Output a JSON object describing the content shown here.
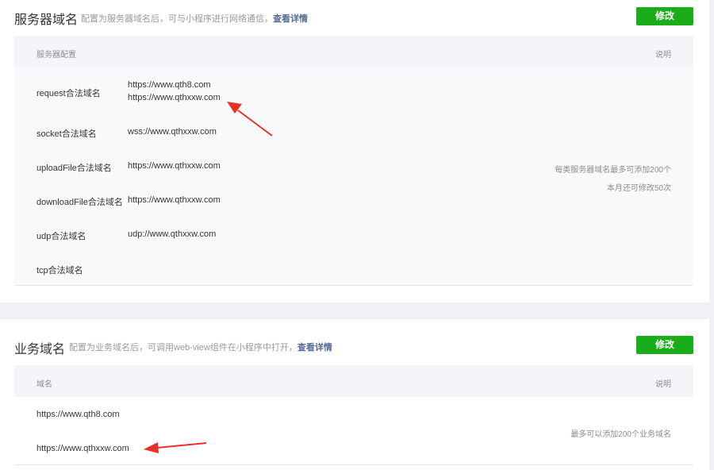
{
  "server_domain": {
    "title": "服务器域名",
    "desc_text": "配置为服务器域名后，可与小程序进行网络通信，",
    "desc_link": "查看详情",
    "button_label": "修改",
    "header_left": "服务器配置",
    "header_right": "说明",
    "rows": [
      {
        "label": "request合法域名",
        "values": [
          "https://www.qth8.com",
          "https://www.qthxxw.com"
        ]
      },
      {
        "label": "socket合法域名",
        "values": [
          "wss://www.qthxxw.com"
        ]
      },
      {
        "label": "uploadFile合法域名",
        "values": [
          "https://www.qthxxw.com"
        ]
      },
      {
        "label": "downloadFile合法域名",
        "values": [
          "https://www.qthxxw.com"
        ]
      },
      {
        "label": "udp合法域名",
        "values": [
          "udp://www.qthxxw.com"
        ]
      },
      {
        "label": "tcp合法域名",
        "values": []
      }
    ],
    "note_line1": "每类服务器域名最多可添加200个",
    "note_line2": "本月还可修改50次"
  },
  "business_domain": {
    "title": "业务域名",
    "desc_text": "配置为业务域名后，可调用web-view组件在小程序中打开，",
    "desc_link": "查看详情",
    "button_label": "修改",
    "header_left": "域名",
    "header_right": "说明",
    "domains": [
      "https://www.qth8.com",
      "https://www.qthxxw.com"
    ],
    "note": "最多可以添加200个业务域名"
  },
  "colors": {
    "button_green": "#1aad19",
    "link_blue": "#576b95",
    "arrow_red": "#e8302a"
  }
}
